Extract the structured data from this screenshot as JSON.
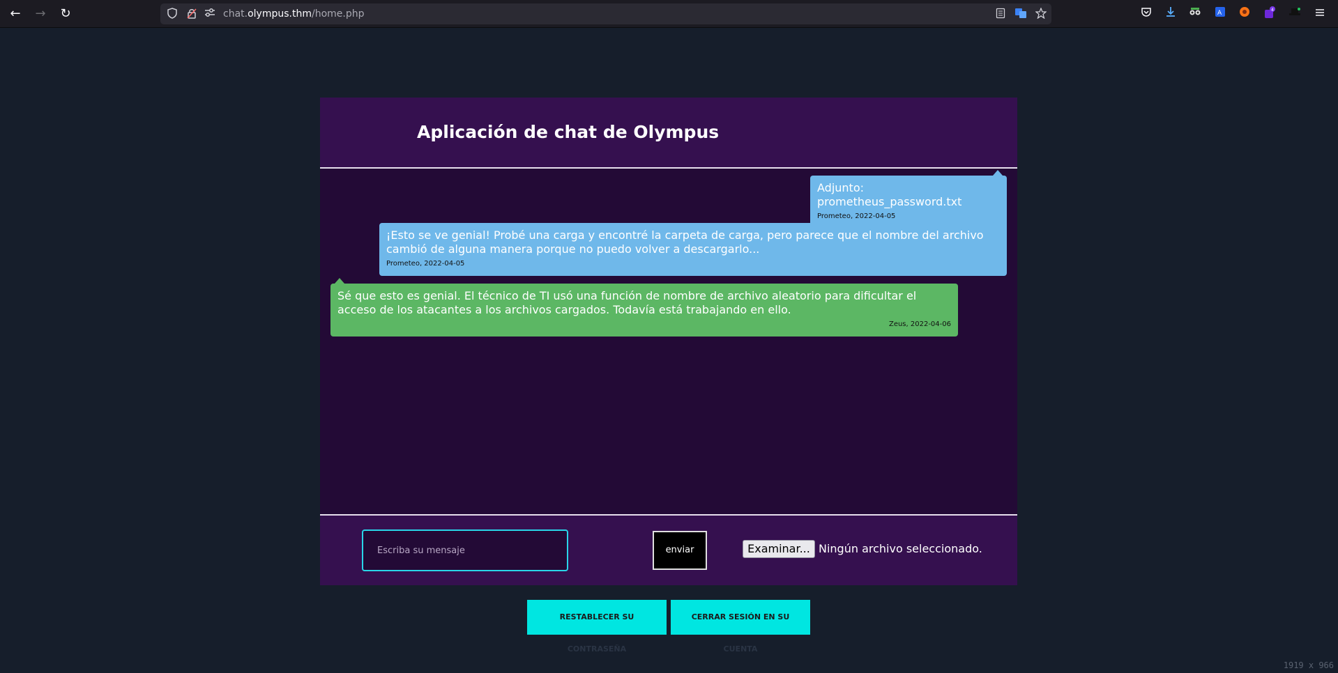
{
  "browser": {
    "url_prefix": "chat.",
    "url_host": "olympus.thm",
    "url_path": "/home.php",
    "back_icon": "←",
    "forward_icon": "→",
    "reload_icon": "↻"
  },
  "header": {
    "title": "Aplicación de chat de Olympus"
  },
  "messages": [
    {
      "text": "Adjunto: prometheus_password.txt",
      "meta": "Prometeo, 2022-04-05",
      "side": "right"
    },
    {
      "text": "¡Esto se ve genial! Probé una carga y encontré la carpeta de carga, pero parece que el nombre del archivo cambió de alguna manera porque no puedo volver a descargarlo...",
      "meta": "Prometeo, 2022-04-05",
      "side": "right"
    },
    {
      "text": "Sé que esto es genial. El técnico de TI usó una función de nombre de archivo aleatorio para dificultar el acceso de los atacantes a los archivos cargados. Todavía está trabajando en ello.",
      "meta": "Zeus, 2022-04-06",
      "side": "left"
    }
  ],
  "composer": {
    "placeholder": "Escriba su mensaje",
    "send_label": "enviar",
    "browse_label": "Examinar...",
    "file_status": "Ningún archivo seleccionado."
  },
  "actions": {
    "reset_label": "RESTABLECER SU",
    "reset_sub": "CONTRASEÑA",
    "logout_label": "CERRAR SESIÓN EN SU",
    "logout_sub": "CUENTA"
  },
  "screen": {
    "dimensions_text": "1919 x 966"
  },
  "colors": {
    "page_bg": "#161e2b",
    "card_bg": "#230a36",
    "header_bg": "#35104f",
    "bubble_blue": "#6fb8ea",
    "bubble_green": "#5cb764",
    "accent_cyan": "#00e6e1"
  }
}
